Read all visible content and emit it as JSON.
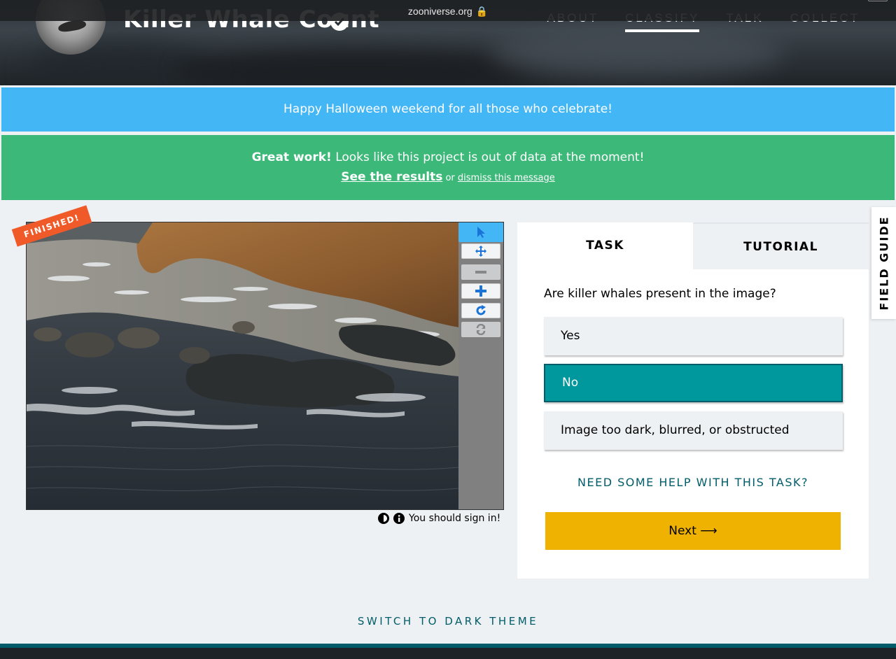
{
  "browser": {
    "url": "zooniverse.org",
    "lock": "🔒"
  },
  "header": {
    "project_title": "Killer Whale Count",
    "nav": [
      "ABOUT",
      "CLASSIFY",
      "TALK",
      "COLLECT"
    ]
  },
  "banners": {
    "announcement": "Happy Halloween weekend for all those who celebrate!",
    "out_of_data": {
      "bold": "Great work!",
      "text": " Looks like this project is out of data at the moment!",
      "results_link": "See the results",
      "or": " or ",
      "dismiss_link": "dismiss this message"
    }
  },
  "viewer": {
    "finished_label": "FINISHED!",
    "sign_in_text": "You should sign in!",
    "tools": [
      "pointer-icon",
      "move-icon",
      "zoom-out-icon",
      "zoom-in-icon",
      "rotate-icon",
      "reset-icon"
    ]
  },
  "task": {
    "tabs": [
      "TASK",
      "TUTORIAL"
    ],
    "question": "Are killer whales present in the image?",
    "answers": [
      "Yes",
      "No",
      "Image too dark, blurred, or obstructed"
    ],
    "selected_answer": "No",
    "help_link": "NEED SOME HELP WITH THIS TASK?",
    "next_label": "Next ⟶"
  },
  "field_guide": "FIELD GUIDE",
  "theme_switch": "SWITCH TO DARK THEME",
  "colors": {
    "blue_banner": "#43b6f5",
    "green_banner": "#3cb878",
    "selected": "#00979d",
    "next": "#f0b200",
    "teal_text": "#005d69"
  }
}
